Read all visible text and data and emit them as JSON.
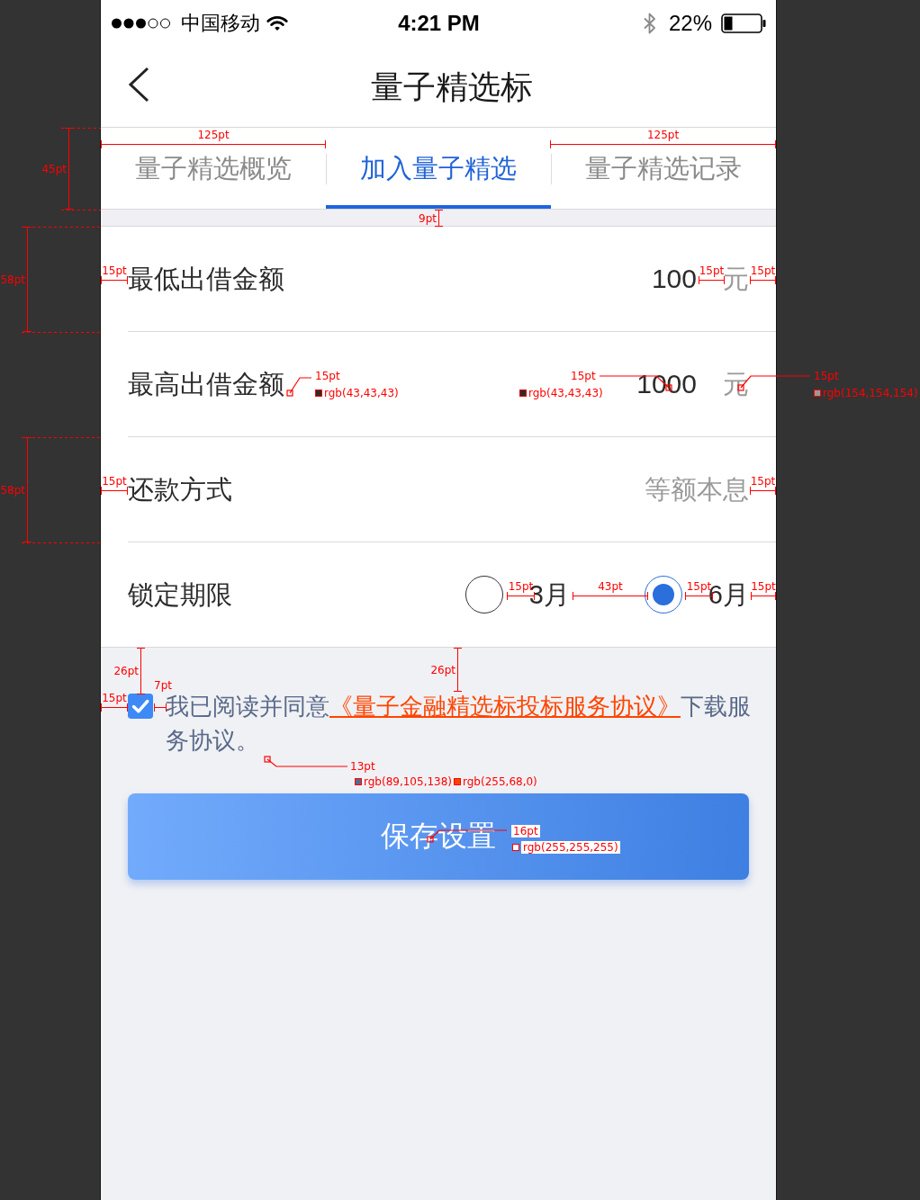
{
  "status_bar": {
    "carrier": "中国移动",
    "time": "4:21 PM",
    "battery_percent": "22%"
  },
  "nav": {
    "title": "量子精选标"
  },
  "tabs": [
    {
      "label": "量子精选概览",
      "selected": false
    },
    {
      "label": "加入量子精选",
      "selected": true
    },
    {
      "label": "量子精选记录",
      "selected": false
    }
  ],
  "form_rows": [
    {
      "kind": "amount",
      "label": "最低出借金额",
      "value": "100",
      "unit": "元"
    },
    {
      "kind": "amount",
      "label": "最高出借金额",
      "value": "1000",
      "unit": "元"
    },
    {
      "kind": "text",
      "label": "还款方式",
      "value": "等额本息"
    },
    {
      "kind": "radio",
      "label": "锁定期限",
      "options": [
        {
          "label": "3月",
          "selected": false
        },
        {
          "label": "6月",
          "selected": true
        }
      ]
    }
  ],
  "agreement": {
    "checked": true,
    "text": "我已阅读并同意",
    "link": "《量子金融精选标投标服务协议》",
    "text_after": "下载服务协议。"
  },
  "save_button": {
    "label": "保存设置"
  },
  "annotations": [
    {
      "kind": "hdim",
      "text": "125pt"
    },
    {
      "kind": "hdim",
      "text": "125pt"
    },
    {
      "kind": "vdim",
      "text": "45pt"
    },
    {
      "kind": "vdim",
      "text": "9pt"
    },
    {
      "kind": "vdim",
      "text": "58pt"
    },
    {
      "kind": "hdim",
      "text": "15pt"
    },
    {
      "kind": "hdim",
      "text": "15pt"
    },
    {
      "kind": "hdim",
      "text": "15pt"
    },
    {
      "kind": "callout",
      "text": "15pt",
      "swatches": [
        {
          "text": "rgb(43,43,43)",
          "color": "#2b2b2b"
        }
      ]
    },
    {
      "kind": "callout",
      "text": "15pt",
      "swatches": [
        {
          "text": "rgb(43,43,43)",
          "color": "#2b2b2b"
        }
      ]
    },
    {
      "kind": "callout",
      "text": "15pt",
      "swatches": [
        {
          "text": "rgb(154,154,154)",
          "color": "#9a9a9a"
        }
      ]
    },
    {
      "kind": "vdim",
      "text": "58pt"
    },
    {
      "kind": "hdim",
      "text": "15pt"
    },
    {
      "kind": "hdim",
      "text": "15pt"
    },
    {
      "kind": "hdim",
      "text": "15pt"
    },
    {
      "kind": "hdim",
      "text": "43pt"
    },
    {
      "kind": "hdim",
      "text": "15pt"
    },
    {
      "kind": "hdim",
      "text": "15pt"
    },
    {
      "kind": "vdim",
      "text": "26pt"
    },
    {
      "kind": "vdim",
      "text": "26pt"
    },
    {
      "kind": "hdim",
      "text": "15pt"
    },
    {
      "kind": "hdim",
      "text": "7pt"
    },
    {
      "kind": "callout",
      "text": "13pt",
      "swatches": [
        {
          "text": "rgb(89,105,138)",
          "color": "#59698a"
        },
        {
          "text": "rgb(255,68,0)",
          "color": "#ff4400"
        }
      ]
    },
    {
      "kind": "callout",
      "text": "16pt",
      "swatches": [
        {
          "text": "rgb(255,255,255)",
          "color": "#ffffff"
        }
      ]
    }
  ]
}
